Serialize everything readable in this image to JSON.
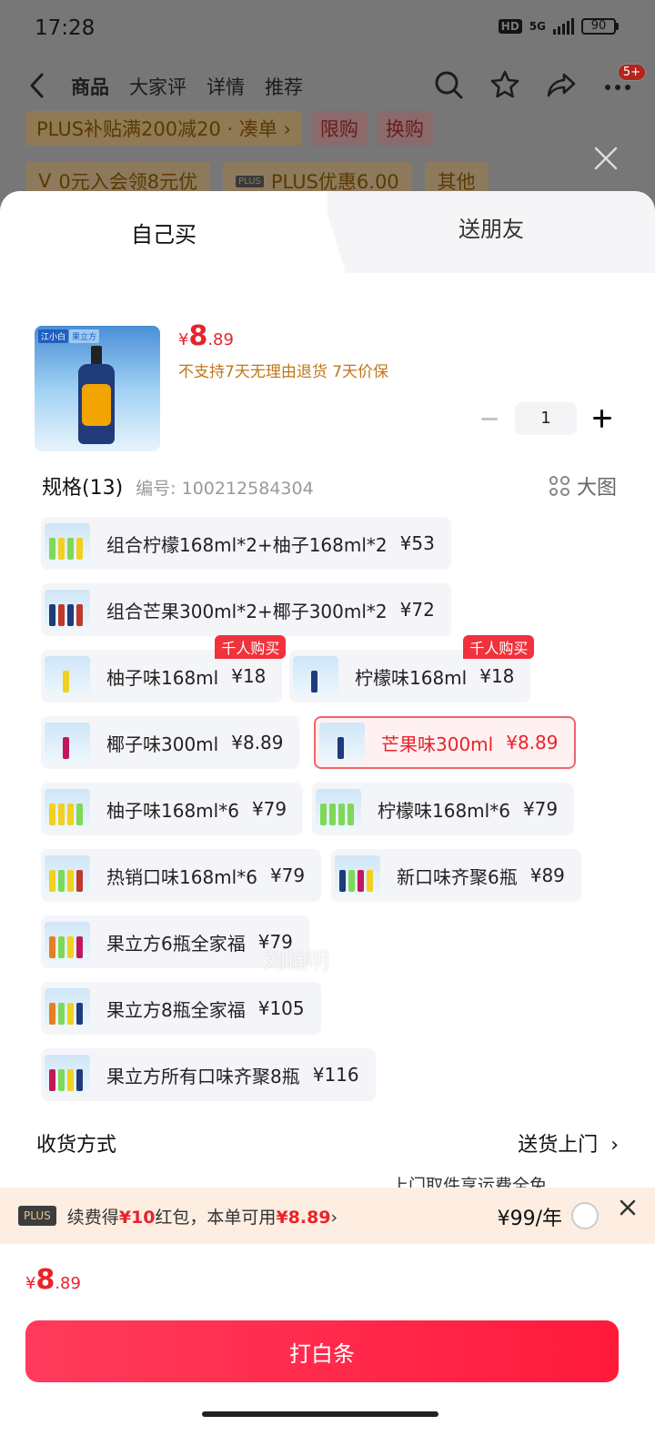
{
  "status": {
    "time": "17:28",
    "hd": "HD",
    "network": "5G",
    "battery": "90"
  },
  "nav": {
    "tabs": [
      "商品",
      "大家评",
      "详情",
      "推荐"
    ],
    "badge": "5+"
  },
  "background_promos": {
    "row1": {
      "text": "PLUS补贴满200减20 · 凑单 ›",
      "tag1": "限购",
      "tag2": "换购"
    },
    "row2": {
      "coupon1": "0元入会领8元优",
      "coupon1_icon": "V",
      "plus_label": "PLUS",
      "coupon2": "PLUS优惠6.00",
      "other": "其他"
    }
  },
  "sheet": {
    "tab_self": "自己买",
    "tab_friend": "送朋友"
  },
  "product": {
    "brand": "江小白",
    "brand_tag": "果立方",
    "price_yen": "¥",
    "price_int": "8",
    "price_dec": ".89",
    "policy": "不支持7天无理由退货  7天价保",
    "quantity": "1"
  },
  "spec": {
    "title": "规格(13)",
    "code": "编号: 100212584304",
    "big_image": "大图"
  },
  "options": [
    {
      "name": "组合柠檬168ml*2+柚子168ml*2",
      "price": "¥53",
      "hot": "",
      "selected": false
    },
    {
      "name": "组合芒果300ml*2+椰子300ml*2",
      "price": "¥72",
      "hot": "",
      "selected": false
    },
    {
      "name": "柚子味168ml",
      "price": "¥18",
      "hot": "千人购买",
      "selected": false
    },
    {
      "name": "柠檬味168ml",
      "price": "¥18",
      "hot": "千人购买",
      "selected": false
    },
    {
      "name": "椰子味300ml",
      "price": "¥8.89",
      "hot": "",
      "selected": false
    },
    {
      "name": "芒果味300ml",
      "price": "¥8.89",
      "hot": "",
      "selected": true
    },
    {
      "name": "柚子味168ml*6",
      "price": "¥79",
      "hot": "",
      "selected": false
    },
    {
      "name": "柠檬味168ml*6",
      "price": "¥79",
      "hot": "",
      "selected": false
    },
    {
      "name": "热销口味168ml*6",
      "price": "¥79",
      "hot": "",
      "selected": false
    },
    {
      "name": "新口味齐聚6瓶",
      "price": "¥89",
      "hot": "",
      "selected": false
    },
    {
      "name": "果立方6瓶全家福",
      "price": "¥79",
      "hot": "",
      "selected": false
    },
    {
      "name": "果立方8瓶全家福",
      "price": "¥105",
      "hot": "",
      "selected": false
    },
    {
      "name": "果立方所有口味齐聚8瓶",
      "price": "¥116",
      "hot": "",
      "selected": false
    }
  ],
  "watermark": "刘柏明",
  "shipping": {
    "label": "收货方式",
    "value": "送货上门",
    "sub": "上门取件享运费全免"
  },
  "plus_banner": {
    "logo": "PLUS",
    "text_pre": "续费得",
    "text_red1": "¥10",
    "text_mid": "红包，本单可用",
    "text_red2": "¥8.89",
    "text_arrow": "›",
    "price": "¥99/年"
  },
  "bottom": {
    "price_yen": "¥",
    "price_int": "8",
    "price_dec": ".89",
    "pay_label": "打白条"
  },
  "colors": {
    "accent": "#e8232c",
    "policy": "#c0761a",
    "plus_bg": "#fdeee1"
  }
}
